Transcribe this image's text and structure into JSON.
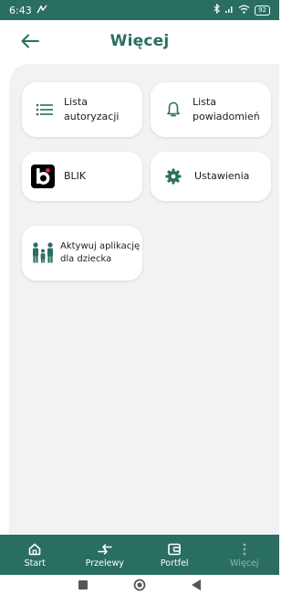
{
  "status_bar": {
    "time": "6:43",
    "battery": "92"
  },
  "header": {
    "title": "Więcej"
  },
  "tiles": {
    "authorizations": {
      "line1": "Lista",
      "line2": "autoryzacji",
      "icon": "list-icon"
    },
    "notifications": {
      "line1": "Lista",
      "line2": "powiadomień",
      "icon": "bell-icon"
    },
    "blik": {
      "label": "BLIK",
      "icon": "blik-logo"
    },
    "settings": {
      "label": "Ustawienia",
      "icon": "gear-icon"
    },
    "child_app": {
      "line1": "Aktywuj aplikację",
      "line2": "dla dziecka",
      "icon": "family-icon"
    }
  },
  "bottom_nav": {
    "items": [
      {
        "label": "Start",
        "icon": "home-icon"
      },
      {
        "label": "Przelewy",
        "icon": "transfer-icon"
      },
      {
        "label": "Portfel",
        "icon": "wallet-icon"
      },
      {
        "label": "Więcej",
        "icon": "more-vertical-icon",
        "active": true
      }
    ]
  },
  "colors": {
    "primary": "#2a6e62",
    "background": "#f2f2f2",
    "nav_active": "#8fb8af"
  }
}
